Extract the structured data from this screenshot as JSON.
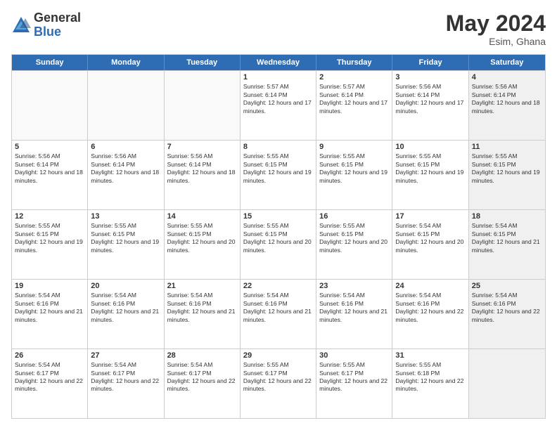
{
  "header": {
    "logo_general": "General",
    "logo_blue": "Blue",
    "month_year": "May 2024",
    "location": "Esim, Ghana"
  },
  "calendar": {
    "days_of_week": [
      "Sunday",
      "Monday",
      "Tuesday",
      "Wednesday",
      "Thursday",
      "Friday",
      "Saturday"
    ],
    "rows": [
      [
        {
          "day": "",
          "empty": true
        },
        {
          "day": "",
          "empty": true
        },
        {
          "day": "",
          "empty": true
        },
        {
          "day": "1",
          "sunrise": "5:57 AM",
          "sunset": "6:14 PM",
          "daylight": "12 hours and 17 minutes."
        },
        {
          "day": "2",
          "sunrise": "5:57 AM",
          "sunset": "6:14 PM",
          "daylight": "12 hours and 17 minutes."
        },
        {
          "day": "3",
          "sunrise": "5:56 AM",
          "sunset": "6:14 PM",
          "daylight": "12 hours and 17 minutes."
        },
        {
          "day": "4",
          "sunrise": "5:56 AM",
          "sunset": "6:14 PM",
          "daylight": "12 hours and 18 minutes.",
          "shaded": true
        }
      ],
      [
        {
          "day": "5",
          "sunrise": "5:56 AM",
          "sunset": "6:14 PM",
          "daylight": "12 hours and 18 minutes."
        },
        {
          "day": "6",
          "sunrise": "5:56 AM",
          "sunset": "6:14 PM",
          "daylight": "12 hours and 18 minutes."
        },
        {
          "day": "7",
          "sunrise": "5:56 AM",
          "sunset": "6:14 PM",
          "daylight": "12 hours and 18 minutes."
        },
        {
          "day": "8",
          "sunrise": "5:55 AM",
          "sunset": "6:15 PM",
          "daylight": "12 hours and 19 minutes."
        },
        {
          "day": "9",
          "sunrise": "5:55 AM",
          "sunset": "6:15 PM",
          "daylight": "12 hours and 19 minutes."
        },
        {
          "day": "10",
          "sunrise": "5:55 AM",
          "sunset": "6:15 PM",
          "daylight": "12 hours and 19 minutes."
        },
        {
          "day": "11",
          "sunrise": "5:55 AM",
          "sunset": "6:15 PM",
          "daylight": "12 hours and 19 minutes.",
          "shaded": true
        }
      ],
      [
        {
          "day": "12",
          "sunrise": "5:55 AM",
          "sunset": "6:15 PM",
          "daylight": "12 hours and 19 minutes."
        },
        {
          "day": "13",
          "sunrise": "5:55 AM",
          "sunset": "6:15 PM",
          "daylight": "12 hours and 19 minutes."
        },
        {
          "day": "14",
          "sunrise": "5:55 AM",
          "sunset": "6:15 PM",
          "daylight": "12 hours and 20 minutes."
        },
        {
          "day": "15",
          "sunrise": "5:55 AM",
          "sunset": "6:15 PM",
          "daylight": "12 hours and 20 minutes."
        },
        {
          "day": "16",
          "sunrise": "5:55 AM",
          "sunset": "6:15 PM",
          "daylight": "12 hours and 20 minutes."
        },
        {
          "day": "17",
          "sunrise": "5:54 AM",
          "sunset": "6:15 PM",
          "daylight": "12 hours and 20 minutes."
        },
        {
          "day": "18",
          "sunrise": "5:54 AM",
          "sunset": "6:15 PM",
          "daylight": "12 hours and 21 minutes.",
          "shaded": true
        }
      ],
      [
        {
          "day": "19",
          "sunrise": "5:54 AM",
          "sunset": "6:16 PM",
          "daylight": "12 hours and 21 minutes."
        },
        {
          "day": "20",
          "sunrise": "5:54 AM",
          "sunset": "6:16 PM",
          "daylight": "12 hours and 21 minutes."
        },
        {
          "day": "21",
          "sunrise": "5:54 AM",
          "sunset": "6:16 PM",
          "daylight": "12 hours and 21 minutes."
        },
        {
          "day": "22",
          "sunrise": "5:54 AM",
          "sunset": "6:16 PM",
          "daylight": "12 hours and 21 minutes."
        },
        {
          "day": "23",
          "sunrise": "5:54 AM",
          "sunset": "6:16 PM",
          "daylight": "12 hours and 21 minutes."
        },
        {
          "day": "24",
          "sunrise": "5:54 AM",
          "sunset": "6:16 PM",
          "daylight": "12 hours and 22 minutes."
        },
        {
          "day": "25",
          "sunrise": "5:54 AM",
          "sunset": "6:16 PM",
          "daylight": "12 hours and 22 minutes.",
          "shaded": true
        }
      ],
      [
        {
          "day": "26",
          "sunrise": "5:54 AM",
          "sunset": "6:17 PM",
          "daylight": "12 hours and 22 minutes."
        },
        {
          "day": "27",
          "sunrise": "5:54 AM",
          "sunset": "6:17 PM",
          "daylight": "12 hours and 22 minutes."
        },
        {
          "day": "28",
          "sunrise": "5:54 AM",
          "sunset": "6:17 PM",
          "daylight": "12 hours and 22 minutes."
        },
        {
          "day": "29",
          "sunrise": "5:55 AM",
          "sunset": "6:17 PM",
          "daylight": "12 hours and 22 minutes."
        },
        {
          "day": "30",
          "sunrise": "5:55 AM",
          "sunset": "6:17 PM",
          "daylight": "12 hours and 22 minutes."
        },
        {
          "day": "31",
          "sunrise": "5:55 AM",
          "sunset": "6:18 PM",
          "daylight": "12 hours and 22 minutes."
        },
        {
          "day": "",
          "empty": true,
          "shaded": true
        }
      ]
    ]
  }
}
